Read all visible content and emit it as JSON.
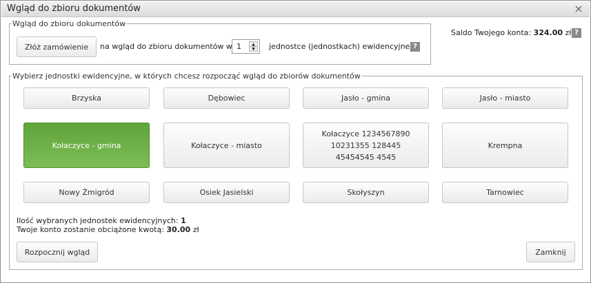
{
  "dialog": {
    "title": "Wgląd do zbioru dokumentów",
    "close_symbol": "×"
  },
  "order": {
    "legend": "Wgląd do zbioru dokumentów",
    "order_button": "Złóż zamówienie",
    "text_before": "na wgląd do zbioru dokumentów w",
    "quantity": "1",
    "text_after": "jednostce (jednostkach) ewidencyjnej",
    "help_symbol": "?"
  },
  "balance": {
    "label": "Saldo Twojego konta:",
    "value": "324.00",
    "currency": "zł",
    "help_symbol": "?"
  },
  "units": {
    "legend": "Wybierz jednostki ewidencyjne, w których chcesz rozpocząć wgląd do zbiorów dokumentów",
    "items": [
      {
        "label": "Brzyska",
        "selected": false
      },
      {
        "label": "Dębowiec",
        "selected": false
      },
      {
        "label": "Jasło - gmina",
        "selected": false
      },
      {
        "label": "Jasło - miasto",
        "selected": false
      },
      {
        "label": "Kołaczyce - gmina",
        "selected": true
      },
      {
        "label": "Kołaczyce - miasto",
        "selected": false
      },
      {
        "label": "Kołaczyce 1234567890 10231355 128445 45454545 4545",
        "selected": false
      },
      {
        "label": "Krempna",
        "selected": false
      },
      {
        "label": "Nowy Żmigród",
        "selected": false
      },
      {
        "label": "Osiek Jasielski",
        "selected": false
      },
      {
        "label": "Skołyszyn",
        "selected": false
      },
      {
        "label": "Tarnowiec",
        "selected": false
      }
    ]
  },
  "summary": {
    "count_label": "Ilość wybranych jednostek ewidencyjnych:",
    "count_value": "1",
    "charge_label": "Twoje konto zostanie obciążone kwotą:",
    "charge_value": "30.00",
    "charge_currency": "zł"
  },
  "actions": {
    "start_button": "Rozpocznij wgląd",
    "close_button": "Zamknij"
  },
  "colors": {
    "selected_bg": "#6fb04a",
    "title_bar": "#e6e6e6"
  }
}
